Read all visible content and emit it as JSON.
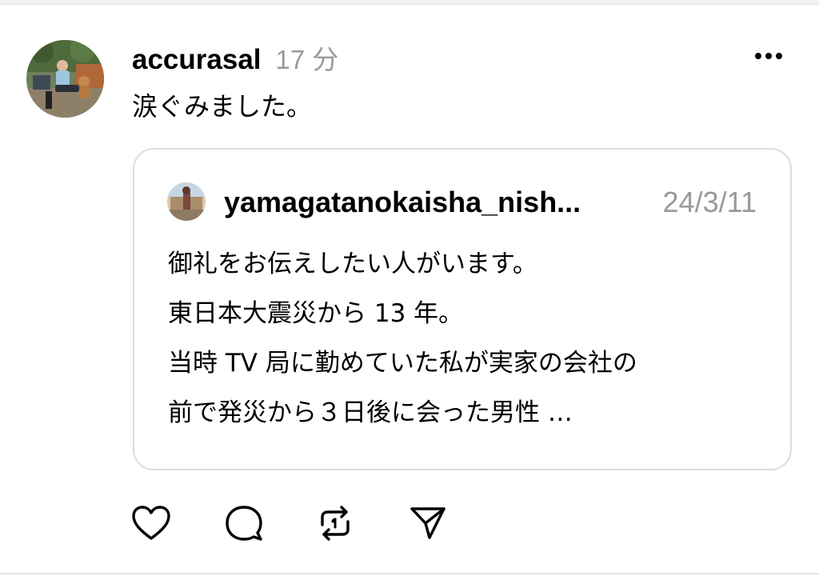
{
  "post": {
    "username": "accurasal",
    "timestamp": "17 分",
    "text": "涙ぐみました。",
    "avatar_icon": "profile-photo-outdoor"
  },
  "more_icon": "more-horizontal-icon",
  "quoted_post": {
    "username": "yamagatanokaisha_nish...",
    "date": "24/3/11",
    "avatar_icon": "profile-photo-scenery",
    "lines": [
      "御礼をお伝えしたい人がいます。",
      "東日本大震災から 13 年。",
      "当時 TV 局に勤めていた私が実家の会社の",
      "前で発災から３日後に会った男性 …"
    ]
  },
  "actions": [
    {
      "icon": "heart-icon",
      "label": "like"
    },
    {
      "icon": "comment-icon",
      "label": "reply"
    },
    {
      "icon": "repost-icon",
      "label": "repost"
    },
    {
      "icon": "send-icon",
      "label": "share"
    }
  ],
  "colors": {
    "text": "#000000",
    "muted": "#9a9a9a",
    "border": "#dcdcdc",
    "divider": "#e4e4e4"
  }
}
